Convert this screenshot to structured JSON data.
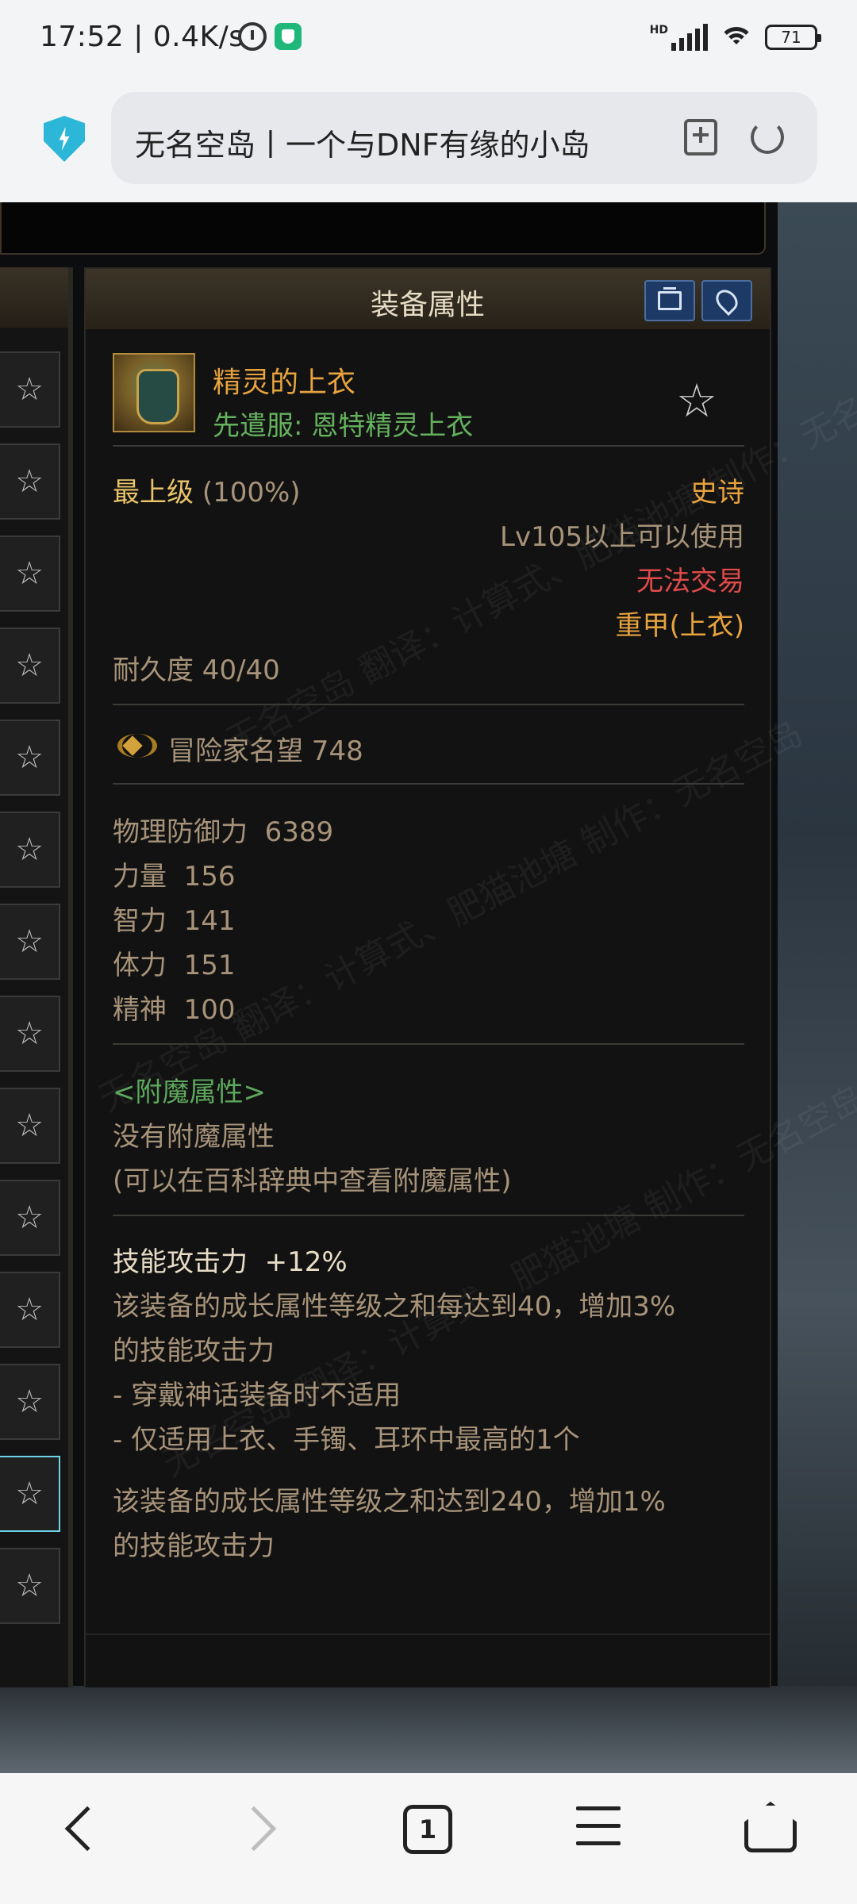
{
  "status_bar": {
    "time": "17:52",
    "net_speed": "0.4K/s",
    "network": "HD",
    "battery": "71"
  },
  "address_bar": {
    "page_title": "无名空岛丨一个与DNF有缘的小岛"
  },
  "panel": {
    "title": "装备属性",
    "item": {
      "name": "精灵的上衣",
      "subtitle": "先遣服: 恩特精灵上衣",
      "grade": "最上级",
      "grade_pct": "(100%)",
      "rarity": "史诗",
      "level_req": "Lv105以上可以使用",
      "trade": "无法交易",
      "type": "重甲(上衣)",
      "durability": "耐久度 40/40",
      "fame": "冒险家名望 748"
    },
    "stats": [
      {
        "label": "物理防御力",
        "value": "6389"
      },
      {
        "label": "力量",
        "value": "156"
      },
      {
        "label": "智力",
        "value": "141"
      },
      {
        "label": "体力",
        "value": "151"
      },
      {
        "label": "精神",
        "value": "100"
      }
    ],
    "enchant": {
      "header": "<附魔属性>",
      "none": "没有附魔属性",
      "hint": "(可以在百科辞典中查看附魔属性)"
    },
    "skill": {
      "title": "技能攻击力",
      "value": "+12%",
      "desc1": "该装备的成长属性等级之和每达到40，增加3%",
      "desc1b": "的技能攻击力",
      "note1": "- 穿戴神话装备时不适用",
      "note2": "- 仅适用上衣、手镯、耳环中最高的1个",
      "desc2": "该装备的成长属性等级之和达到240，增加1%",
      "desc2b": "的技能攻击力"
    }
  },
  "nav": {
    "tab_count": "1"
  },
  "colors": {
    "epic": "#e8a33f",
    "set": "#5da85c",
    "untradeable": "#e04a4a",
    "grade": "#e8c36b"
  }
}
